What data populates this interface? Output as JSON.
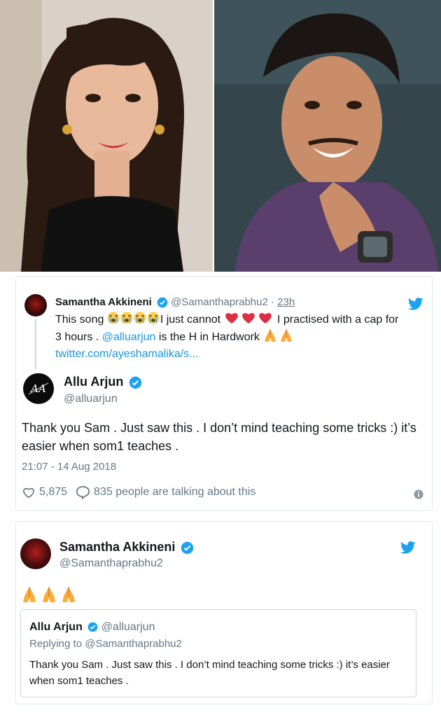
{
  "photos": {
    "left_alt": "",
    "right_alt": ""
  },
  "embedded_tweet": {
    "quoted": {
      "name": "Samantha Akkineni",
      "handle": "@Samanthaprabhu2",
      "separator": " · ",
      "time": "23h",
      "text_before": "This song ",
      "text_mid1": "I just cannot ",
      "text_mid2": " I practised with a cap for 3 hours . ",
      "mention": "@alluarjun",
      "text_after": " is the H in Hardwork ",
      "link": "twitter.com/ayeshamalika/s..."
    },
    "author": {
      "name": "Allu Arjun",
      "handle": "@alluarjun"
    },
    "text": "Thank you Sam . Just saw this . I don’t mind teaching some tricks :) it’s easier when som1 teaches .",
    "datetime": "21:07 - 14 Aug 2018",
    "likes": "5,875",
    "talking": "835 people are talking about this"
  },
  "reply_tweet": {
    "author": {
      "name": "Samantha Akkineni",
      "handle": "@Samanthaprabhu2"
    },
    "quote": {
      "name": "Allu Arjun",
      "handle": "@alluarjun",
      "replying_to": "Replying to @Samanthaprabhu2",
      "text": "Thank you Sam . Just saw this . I don’t mind teaching some tricks :) it’s easier when som1 teaches ."
    }
  },
  "colors": {
    "twitter_blue": "#1da1f2",
    "link": "#1b95e0",
    "heart": "#e0245e",
    "muted": "#657786",
    "border": "#e1e8ed"
  },
  "icons": [
    "twitter-bird-icon",
    "verified-badge-icon",
    "crying-emoji-icon",
    "red-heart-emoji-icon",
    "folded-hands-emoji-icon",
    "heart-outline-icon",
    "speech-bubble-icon",
    "info-icon"
  ]
}
